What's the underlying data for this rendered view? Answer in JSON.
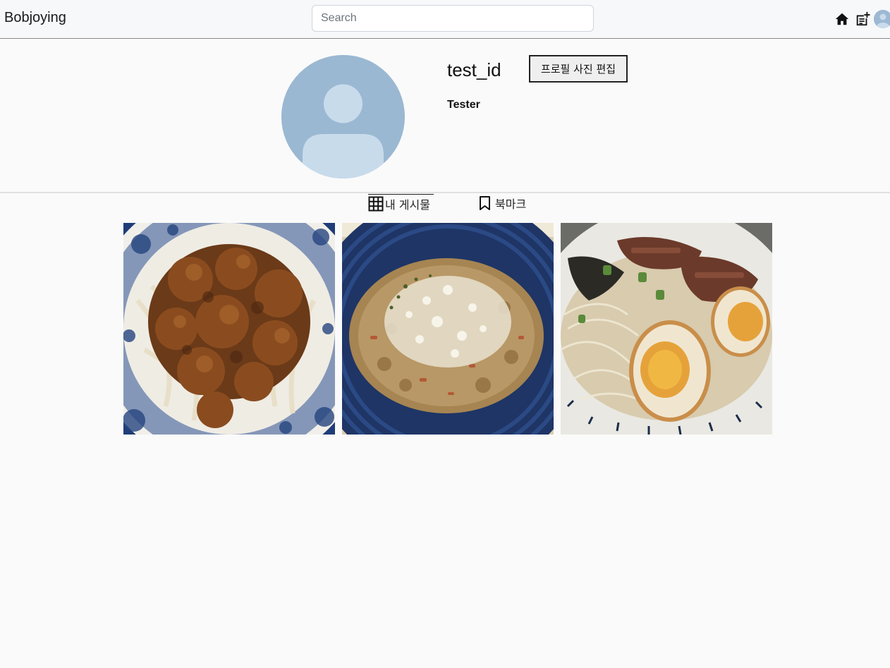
{
  "header": {
    "brand": "Bobjoying",
    "search_placeholder": "Search",
    "icons": [
      "home-icon",
      "new-post-icon",
      "user-avatar"
    ]
  },
  "profile": {
    "username": "test_id",
    "edit_button_label": "프로필 사진 편집",
    "display_name": "Tester"
  },
  "tabs": [
    {
      "label": "내 게시물",
      "icon": "grid-icon",
      "active": true
    },
    {
      "label": "북마크",
      "icon": "bookmark-icon",
      "active": false
    }
  ],
  "posts": [
    {
      "subject": "fried chicken over onions on blue-and-white plate"
    },
    {
      "subject": "risotto with grated cheese in blue bowl"
    },
    {
      "subject": "ramen with chashu, soft-boiled eggs and bean sprouts"
    }
  ],
  "colors": {
    "avatar_bg": "#9ab8d2",
    "page_bg": "#fafafa"
  }
}
